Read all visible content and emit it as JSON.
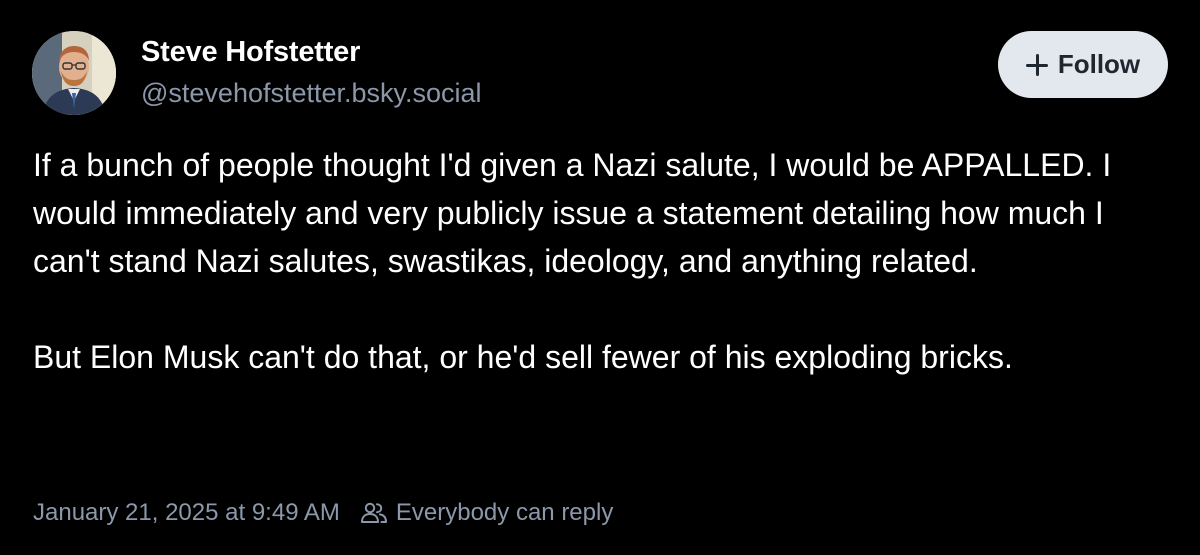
{
  "author": {
    "name": "Steve Hofstetter",
    "handle": "@stevehofstetter.bsky.social",
    "avatar_icon": "avatar-photo"
  },
  "follow_button": {
    "label": "Follow",
    "icon": "plus-icon"
  },
  "post": {
    "paragraphs": [
      "If a bunch of people thought I'd given a Nazi salute, I would be APPALLED. I would immediately and very publicly issue a statement detailing how much I can't stand Nazi salutes, swastikas, ideology, and anything related.",
      "But Elon Musk can't do that, or he'd sell fewer of his exploding bricks."
    ]
  },
  "meta": {
    "timestamp": "January 21, 2025 at 9:49 AM",
    "reply_setting": "Everybody can reply",
    "reply_icon": "people-icon"
  },
  "colors": {
    "background": "#000000",
    "text": "#ffffff",
    "secondary_text": "#8b98a9",
    "follow_button_bg": "#e3e8ee"
  }
}
